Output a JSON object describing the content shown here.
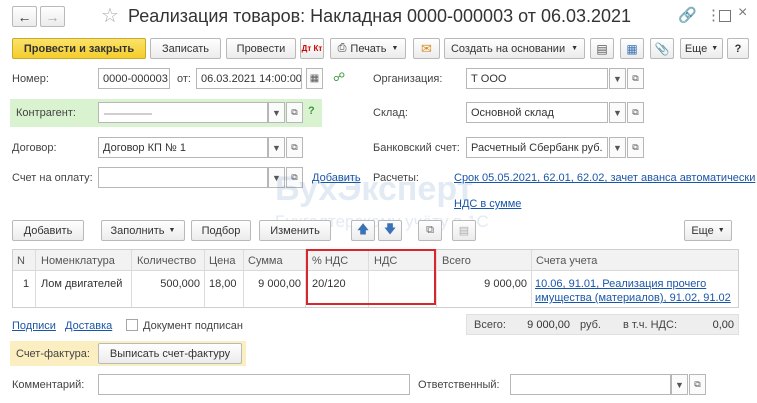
{
  "window": {
    "title": "Реализация товаров: Накладная 0000-000003 от 06.03.2021"
  },
  "toolbar": {
    "post_close": "Провести и закрыть",
    "save": "Записать",
    "post": "Провести",
    "dtkt": "Дт Кт",
    "print": "Печать",
    "create_based": "Создать на основании",
    "more": "Еще",
    "help": "?"
  },
  "form": {
    "number_label": "Номер:",
    "number_value": "0000-000003",
    "from_label": "от:",
    "date_value": "06.03.2021 14:00:00",
    "org_label": "Организация:",
    "org_value": "Т                ООО",
    "counterparty_label": "Контрагент:",
    "counterparty_value": "",
    "counterparty_help": "?",
    "warehouse_label": "Склад:",
    "warehouse_value": "Основной склад",
    "contract_label": "Договор:",
    "contract_value": "Договор КП №                    1",
    "bank_label": "Банковский счет:",
    "bank_value": "Расчетный Сбербанк руб.",
    "invoice_label": "Счет на оплату:",
    "invoice_value": "",
    "add_link": "Добавить",
    "settlements_label": "Расчеты:",
    "settlements_link": "Срок 05.05.2021, 62.01, 62.02, зачет аванса автоматически",
    "vat_link": "НДС в сумме"
  },
  "table_toolbar": {
    "add": "Добавить",
    "fill": "Заполнить",
    "pick": "Подбор",
    "change": "Изменить",
    "more": "Еще"
  },
  "table": {
    "headers": [
      "N",
      "Номенклатура",
      "Количество",
      "Цена",
      "Сумма",
      "% НДС",
      "НДС",
      "Всего",
      "Счета учета"
    ],
    "row": {
      "n": "1",
      "item": "Лом двигателей",
      "qty": "500,000",
      "price": "18,00",
      "sum": "9 000,00",
      "vat_rate": "20/120",
      "vat": "",
      "total": "9 000,00",
      "accounts_line1": "10.06, 91.01, Реализация прочего",
      "accounts_line2": "имущества (материалов), 91.02, 91.02"
    }
  },
  "footer": {
    "signatures_link": "Подписи",
    "delivery_link": "Доставка",
    "signed_label": "Документ подписан",
    "total_label": "Всего:",
    "total_value": "9 000,00",
    "currency": "руб.",
    "vat_incl_label": "в т.ч. НДС:",
    "vat_incl_value": "0,00",
    "invoice_label": "Счет-фактура:",
    "issue_invoice_button": "Выписать счет-фактуру",
    "comment_label": "Комментарий:",
    "comment_value": "",
    "responsible_label": "Ответственный:",
    "responsible_value": ""
  },
  "watermark": {
    "main": "БухЭксперт",
    "sub": "Бухгалтерскому учёту в 1С"
  },
  "colors": {
    "accent_yellow": "#f4cd2c",
    "link_blue": "#1a56a8",
    "highlight_green": "#d9f2cf",
    "highlight_yellow": "#fbeec0",
    "red_box": "#d9262c"
  }
}
